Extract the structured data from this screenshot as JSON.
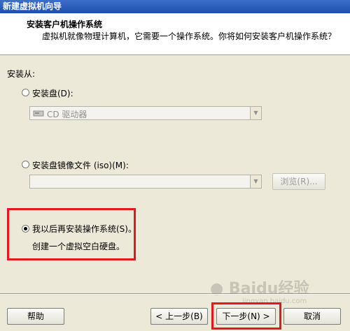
{
  "window": {
    "title": "新建虚拟机向导"
  },
  "header": {
    "title": "安装客户机操作系统",
    "description": "虚拟机就像物理计算机，它需要一个操作系统。你将如何安装客户机操作系统？"
  },
  "install_from": {
    "label": "安装从:",
    "options": [
      {
        "label": "安装盘(D):",
        "selected": false
      },
      {
        "label": "安装盘镜像文件 (iso)(M):",
        "selected": false
      },
      {
        "label": "我以后再安装操作系统(S)。",
        "selected": true
      }
    ],
    "disc_drive_value": "CD 驱动器",
    "iso_path_value": "",
    "browse_label": "浏览(R)...",
    "later_description": "创建一个虚拟空白硬盘。"
  },
  "footer": {
    "help_label": "帮助",
    "back_label": "< 上一步(B)",
    "next_label": "下一步(N) >",
    "cancel_label": "取消"
  },
  "watermark": {
    "text": "Baidu经验",
    "url": "jingyan.baidu.com"
  },
  "colors": {
    "highlight": "#e0191f",
    "titlebar": "#1d4fae"
  },
  "icons": {
    "disc_drive": "cd-drive-icon",
    "dropdown": "chevron-down-icon",
    "watermark_paw": "baidu-paw-icon"
  }
}
